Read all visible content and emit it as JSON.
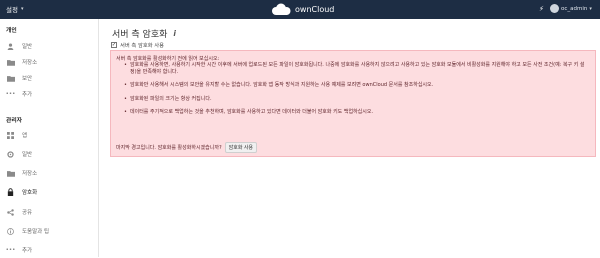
{
  "header": {
    "settings_label": "설정",
    "brand": "ownCloud",
    "user_name": "oc_admin",
    "icons": {
      "caret": "chevron-down-icon",
      "bolt": "bolt-icon",
      "cloud": "cloud-logo-icon"
    }
  },
  "sidebar": {
    "personal_title": "개인",
    "personal_items": [
      {
        "label": "일반",
        "icon": "user-icon"
      },
      {
        "label": "저장소",
        "icon": "folder-icon"
      },
      {
        "label": "보안",
        "icon": "folder-icon"
      },
      {
        "label": "추가",
        "icon": "more-dots-icon"
      }
    ],
    "admin_title": "관리자",
    "admin_items": [
      {
        "label": "앱",
        "icon": "apps-icon"
      },
      {
        "label": "일반",
        "icon": "gear-icon"
      },
      {
        "label": "저장소",
        "icon": "folder-icon"
      },
      {
        "label": "암호화",
        "icon": "lock-icon"
      },
      {
        "label": "공유",
        "icon": "share-icon"
      },
      {
        "label": "도움말과 팁",
        "icon": "info-icon"
      },
      {
        "label": "추가",
        "icon": "more-dots-icon"
      }
    ]
  },
  "main": {
    "title": "서버 측 암호화",
    "info_glyph": "i",
    "enable_label": "서버 측 암호화 사용",
    "warning": {
      "intro": "서버 측 암호화를 활성화하기 전에 읽어 보십시오:",
      "bullets": [
        "암호화를 사용하면, 사용하기 시작한 시간 이후에 서버에 업로드된 모든 파일이 암호화됩니다. 나중에 암호화를 사용하지 않으려고 사용하고 있는 암호화 모듈에서 비활성화를 지원해야 하고 모든 사전 조건(예: 복구 키 설정)을 만족해야 합니다.",
        "암호화만 사용해서 시스템의 보안을 유지할 수는 없습니다. 암호화 앱 동작 방식과 지원하는 사용 예제를 보려면 ownCloud 문서를 참조하십시오.",
        "암호화된 파일의 크기는 항상 커집니다.",
        "데이터를 주기적으로 백업하는 것을 추천하며, 암호화를 사용하고 있다면 데이터와 더불어 암호화 키도 백업하십시오."
      ],
      "question": "마지막 경고입니다. 암호화를 활성화하시겠습니까?",
      "button_label": "암호화 사용"
    }
  }
}
